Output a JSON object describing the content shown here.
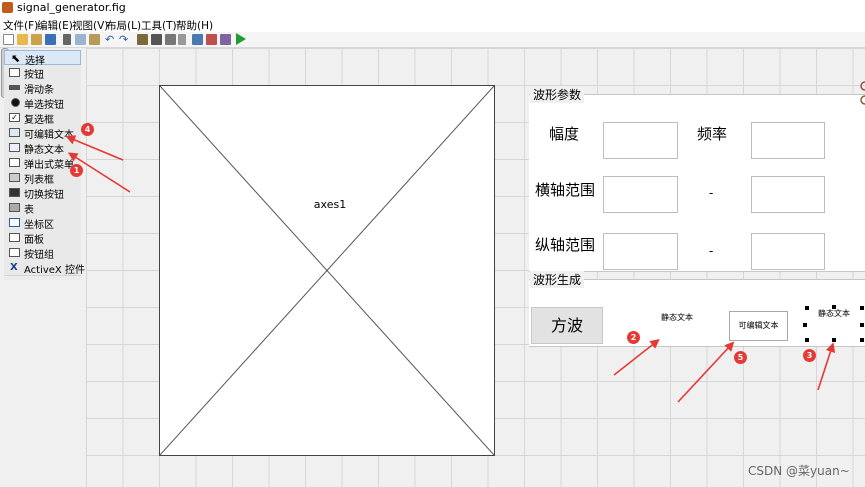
{
  "window": {
    "title": "signal_generator.fig"
  },
  "menu": [
    "文件(F)",
    "编辑(E)",
    "视图(V)",
    "布局(L)",
    "工具(T)",
    "帮助(H)"
  ],
  "toolbar_icons": [
    "new-icon",
    "open-icon",
    "open-folder-icon",
    "save-icon",
    "cut-icon",
    "copy-icon",
    "paste-icon",
    "undo-icon",
    "redo-icon",
    "align-icon",
    "menu-editor-icon",
    "tab-order-icon",
    "toolbar-editor-icon",
    "editor-icon",
    "inspector-icon",
    "browser-icon",
    "run-icon"
  ],
  "palette": [
    "选择",
    "按钮",
    "滑动条",
    "单选按钮",
    "复选框",
    "可编辑文本",
    "静态文本",
    "弹出式菜单",
    "列表框",
    "切换按钮",
    "表",
    "坐标区",
    "面板",
    "按钮组",
    "ActiveX 控件"
  ],
  "axes": {
    "label": "axes1"
  },
  "panel_params": {
    "title": "波形参数",
    "amplitude_label": "幅度",
    "frequency_label": "频率",
    "xrange_label": "横轴范围",
    "yrange_label": "纵轴范围",
    "dash1": "-",
    "dash2": "-"
  },
  "panel_gen": {
    "title": "波形生成"
  },
  "button_square": "方波",
  "static_text_1": "静态文本",
  "static_text_2": "静态文本",
  "editable_text": "可编辑文本",
  "annotations": [
    "1",
    "2",
    "3",
    "4",
    "5"
  ],
  "watermark": "CSDN @菜yuan~",
  "colors": {
    "accent_red": "#e53935",
    "selection_blue": "#dbe8f5",
    "grid": "#d6d6d6"
  }
}
